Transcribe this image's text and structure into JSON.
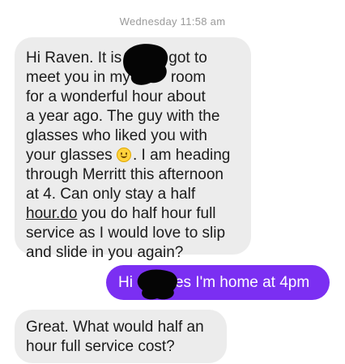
{
  "conversation": {
    "timestamp": "Wednesday 11:58 am",
    "messages": [
      {
        "sender": "incoming",
        "lines": [
          "Hi Raven. It is",
          "got to",
          "meet you in my",
          "room",
          "for a wonderful hour about",
          "a year ago. The guy with the",
          "glasses who liked you with",
          "your glasses",
          ". I am heading",
          "through Merritt this afternoon",
          "at 4. Can only stay a half",
          "hour.do",
          " you do half hour full",
          "service as I would love to slip",
          "and slide in you again?"
        ],
        "emoji": "slightly-smiling-face"
      },
      {
        "sender": "outgoing",
        "prefix": "Hi",
        "text": "es I'm home at 4pm",
        "color": "#7b2ff2"
      },
      {
        "sender": "incoming",
        "lines": [
          "Great. What would half an",
          "hour full service cost?"
        ]
      }
    ],
    "colors": {
      "incoming_bubble": "#ececec",
      "outgoing_bubble": "#7b2ff2",
      "redaction": "#050505"
    }
  }
}
